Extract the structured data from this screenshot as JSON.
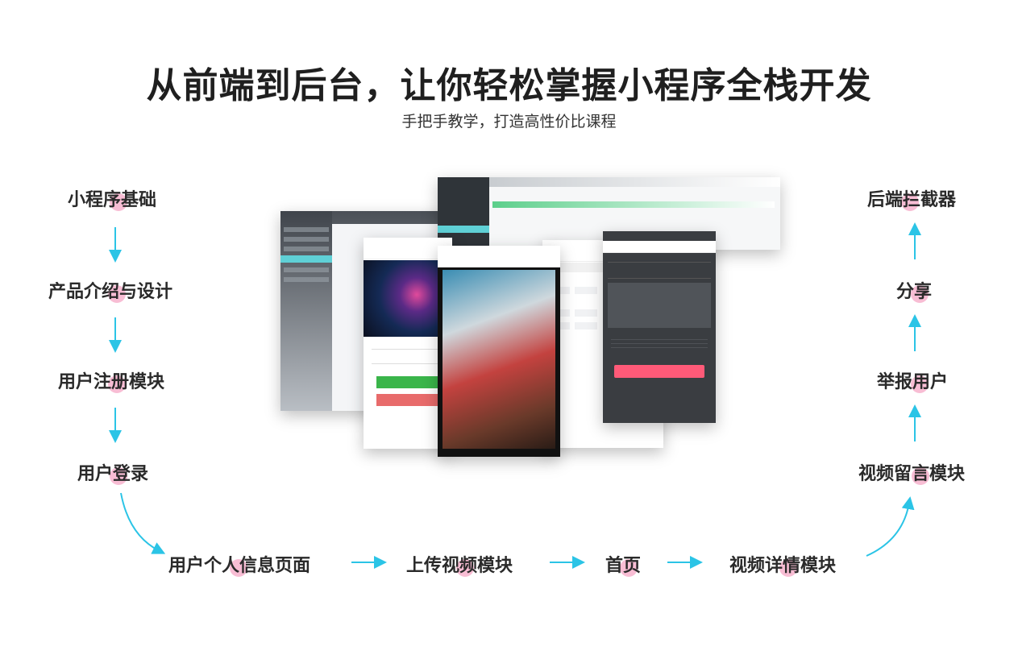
{
  "header": {
    "title": "从前端到后台，让你轻松掌握小程序全栈开发",
    "subtitle": "手把手教学，打造高性价比课程"
  },
  "flow": {
    "left_column": [
      "小程序基础",
      "产品介绍与设计",
      "用户注册模块",
      "用户登录"
    ],
    "bottom_row": [
      "用户个人信息页面",
      "上传视频模块",
      "首页",
      "视频详情模块"
    ],
    "right_column": [
      "视频留言模块",
      "举报用户",
      "分享",
      "后端拦截器"
    ]
  },
  "colors": {
    "arrow": "#2bc4e6",
    "highlight_dot": "#f6a7c6",
    "title": "#1f1f1f"
  }
}
